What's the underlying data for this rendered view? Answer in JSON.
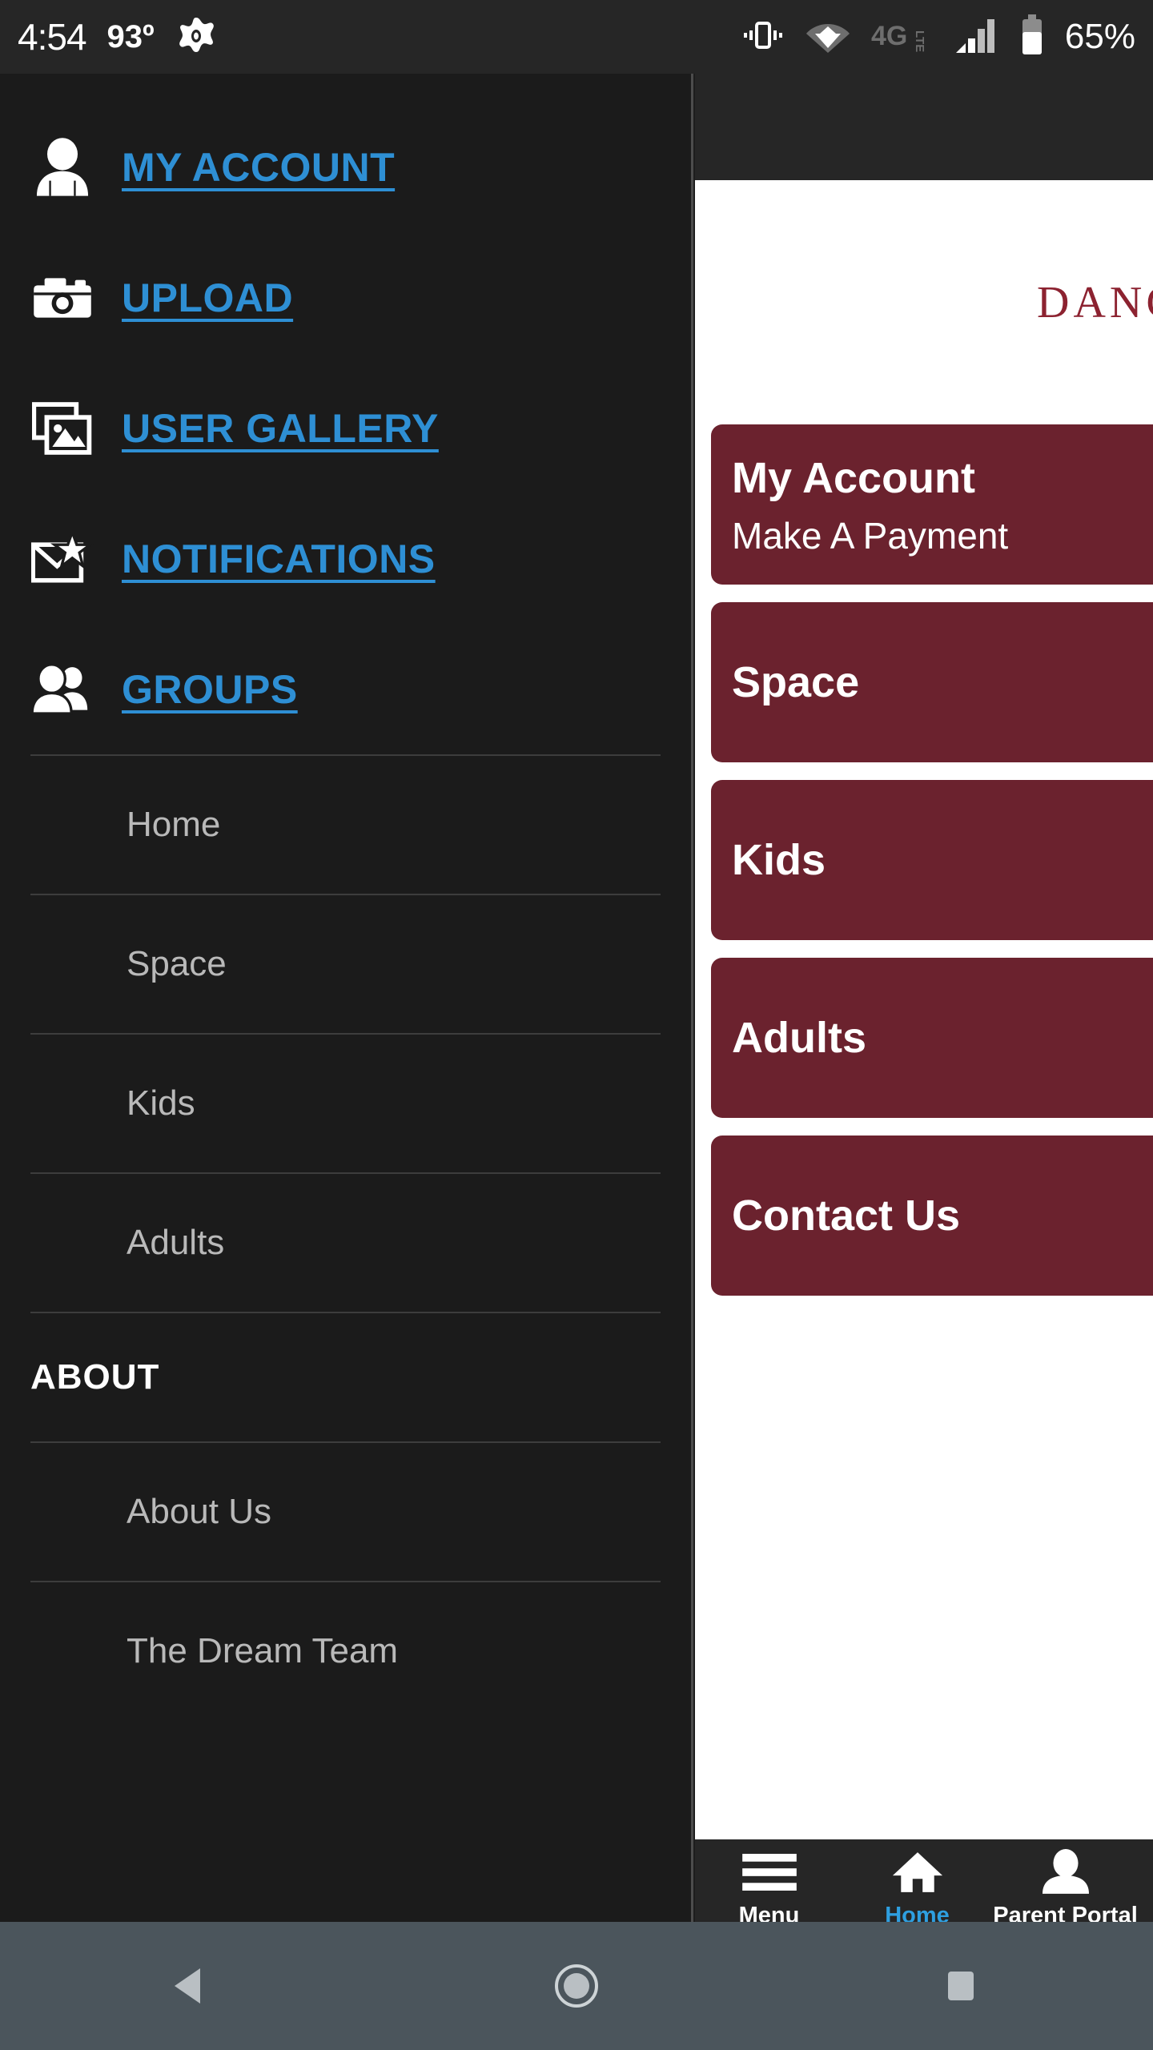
{
  "status_bar": {
    "time": "4:54",
    "temperature": "93º",
    "app_icon": "avast-icon",
    "icons": [
      "vibrate-icon",
      "wifi-icon",
      "4g-lte-icon",
      "signal-bars-icon",
      "battery-icon"
    ],
    "battery_percent": "65%"
  },
  "drawer": {
    "main_links": [
      {
        "label": "MY ACCOUNT",
        "icon": "person-icon"
      },
      {
        "label": "UPLOAD",
        "icon": "camera-icon"
      },
      {
        "label": "USER GALLERY",
        "icon": "photo-stack-icon"
      },
      {
        "label": "NOTIFICATIONS",
        "icon": "envelope-star-icon"
      },
      {
        "label": "GROUPS",
        "icon": "people-icon"
      }
    ],
    "group_items": [
      "Home",
      "Space",
      "Kids",
      "Adults"
    ],
    "about_heading": "ABOUT",
    "about_items": [
      "About Us",
      "The Dream Team"
    ]
  },
  "content": {
    "brand_title": "DANCE",
    "tiles": [
      {
        "title": "My Account",
        "subtitle": "Make A Payment"
      },
      {
        "title": "Space",
        "subtitle": ""
      },
      {
        "title": "Kids",
        "subtitle": ""
      },
      {
        "title": "Adults",
        "subtitle": ""
      },
      {
        "title": "Contact Us",
        "subtitle": ""
      }
    ]
  },
  "bottom_nav": {
    "items": [
      {
        "label": "Menu",
        "icon": "hamburger-icon",
        "active": false
      },
      {
        "label": "Home",
        "icon": "house-icon",
        "active": true
      },
      {
        "label": "Parent Portal",
        "icon": "person-icon",
        "active": false
      }
    ]
  },
  "system_nav": {
    "back": "back-triangle-icon",
    "home": "home-circle-icon",
    "recents": "recents-square-icon"
  },
  "colors": {
    "accent_blue": "#2e8fd4",
    "brand_maroon": "#6b222e",
    "brand_title_red": "#8c2230",
    "drawer_bg": "#1b1b1b",
    "status_bg": "#262626",
    "sysnav_bg": "#4b555c"
  }
}
